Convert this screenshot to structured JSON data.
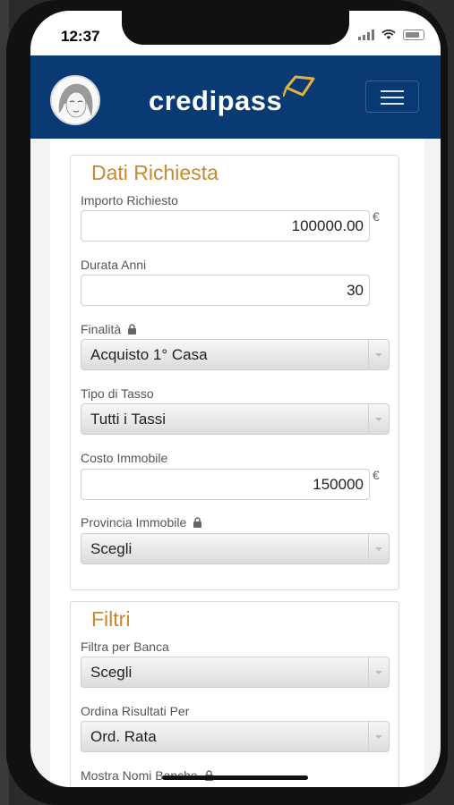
{
  "status_bar": {
    "time": "12:37"
  },
  "header": {
    "brand": "credipass"
  },
  "section_request": {
    "title": "Dati Richiesta",
    "importo": {
      "label": "Importo Richiesto",
      "value": "100000.00",
      "currency": "€"
    },
    "durata": {
      "label": "Durata Anni",
      "value": "30"
    },
    "finalita": {
      "label": "Finalità",
      "selected": "Acquisto 1° Casa"
    },
    "tasso": {
      "label": "Tipo di Tasso",
      "selected": "Tutti i Tassi"
    },
    "costo": {
      "label": "Costo Immobile",
      "value": "150000",
      "currency": "€"
    },
    "provincia": {
      "label": "Provincia Immobile",
      "selected": "Scegli"
    }
  },
  "section_filters": {
    "title": "Filtri",
    "banca": {
      "label": "Filtra per Banca",
      "selected": "Scegli"
    },
    "ordina": {
      "label": "Ordina Risultati Per",
      "selected": "Ord. Rata"
    },
    "mostra": {
      "label": "Mostra Nomi Banche"
    }
  },
  "colors": {
    "header_bg": "#0a3a74",
    "accent_title": "#c9892e",
    "logo_mark": "#e0b341"
  }
}
